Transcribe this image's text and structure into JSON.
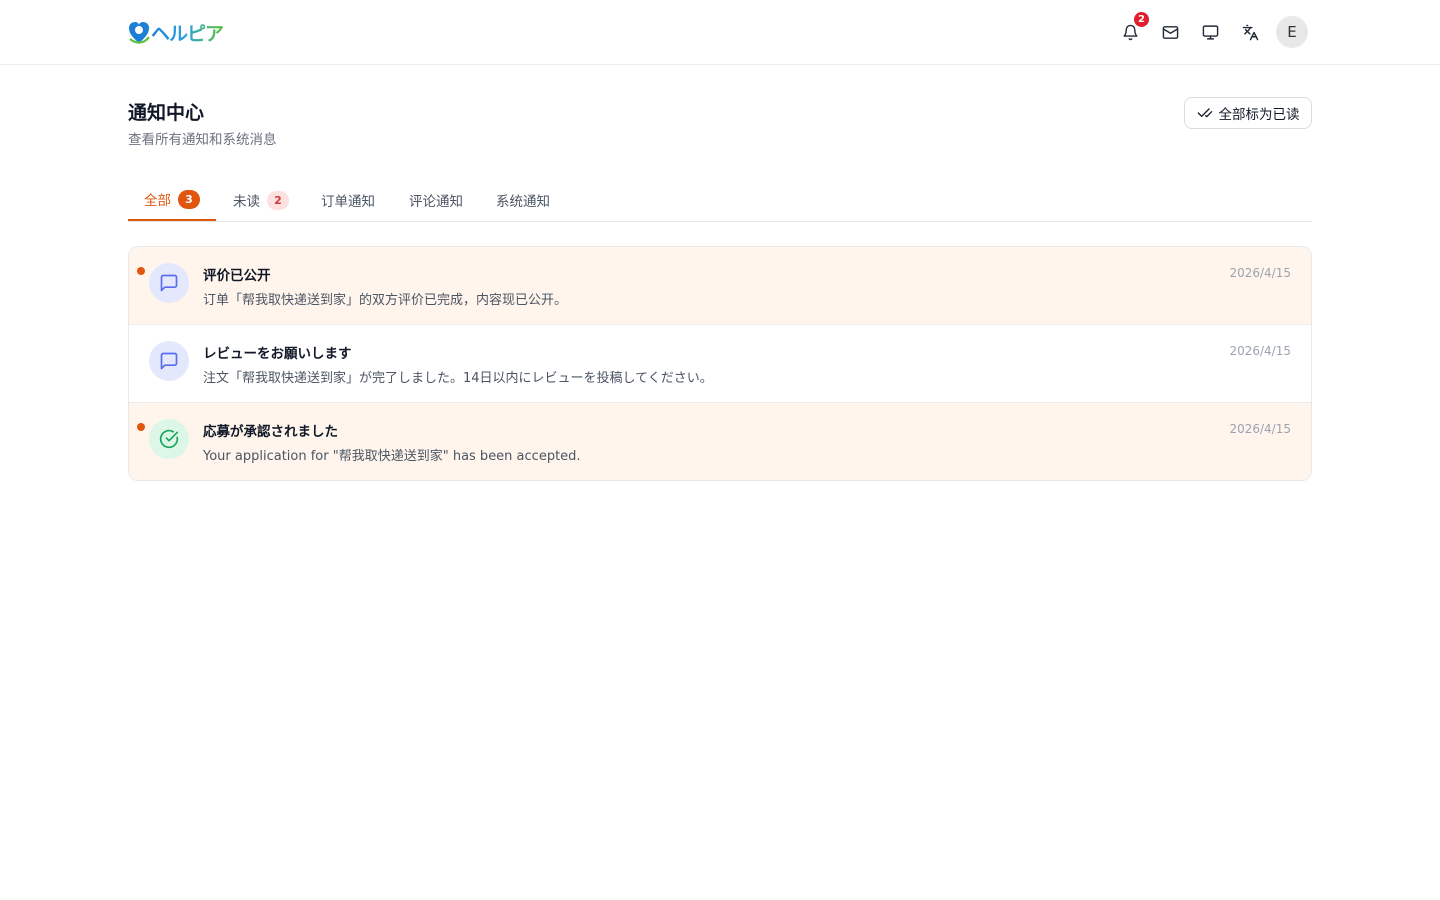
{
  "header": {
    "logo_text": "ヘルピア",
    "notification_count": "2",
    "avatar_initial": "E"
  },
  "page": {
    "title": "通知中心",
    "subtitle": "查看所有通知和系统消息",
    "mark_all_label": "全部标为已读"
  },
  "tabs": [
    {
      "label": "全部",
      "count": "3",
      "active": true
    },
    {
      "label": "未读",
      "count": "2",
      "active": false
    },
    {
      "label": "订单通知",
      "active": false
    },
    {
      "label": "评论通知",
      "active": false
    },
    {
      "label": "系统通知",
      "active": false
    }
  ],
  "notifications": [
    {
      "title": "评价已公开",
      "body": "订单「帮我取快递送到家」的双方评价已完成，内容现已公开。",
      "date": "2026/4/15",
      "unread": true,
      "icon": "message-icon"
    },
    {
      "title": "レビューをお願いします",
      "body": "注文「帮我取快递送到家」が完了しました。14日以内にレビューを投稿してください。",
      "date": "2026/4/15",
      "unread": false,
      "icon": "message-icon"
    },
    {
      "title": "応募が承認されました",
      "body": "Your application for \"帮我取快递送到家\" has been accepted.",
      "date": "2026/4/15",
      "unread": true,
      "icon": "check-circle-icon"
    }
  ],
  "colors": {
    "accent": "#e0560f",
    "unread_row_bg": "#fff5ec",
    "badge_red": "#e11d2e"
  }
}
